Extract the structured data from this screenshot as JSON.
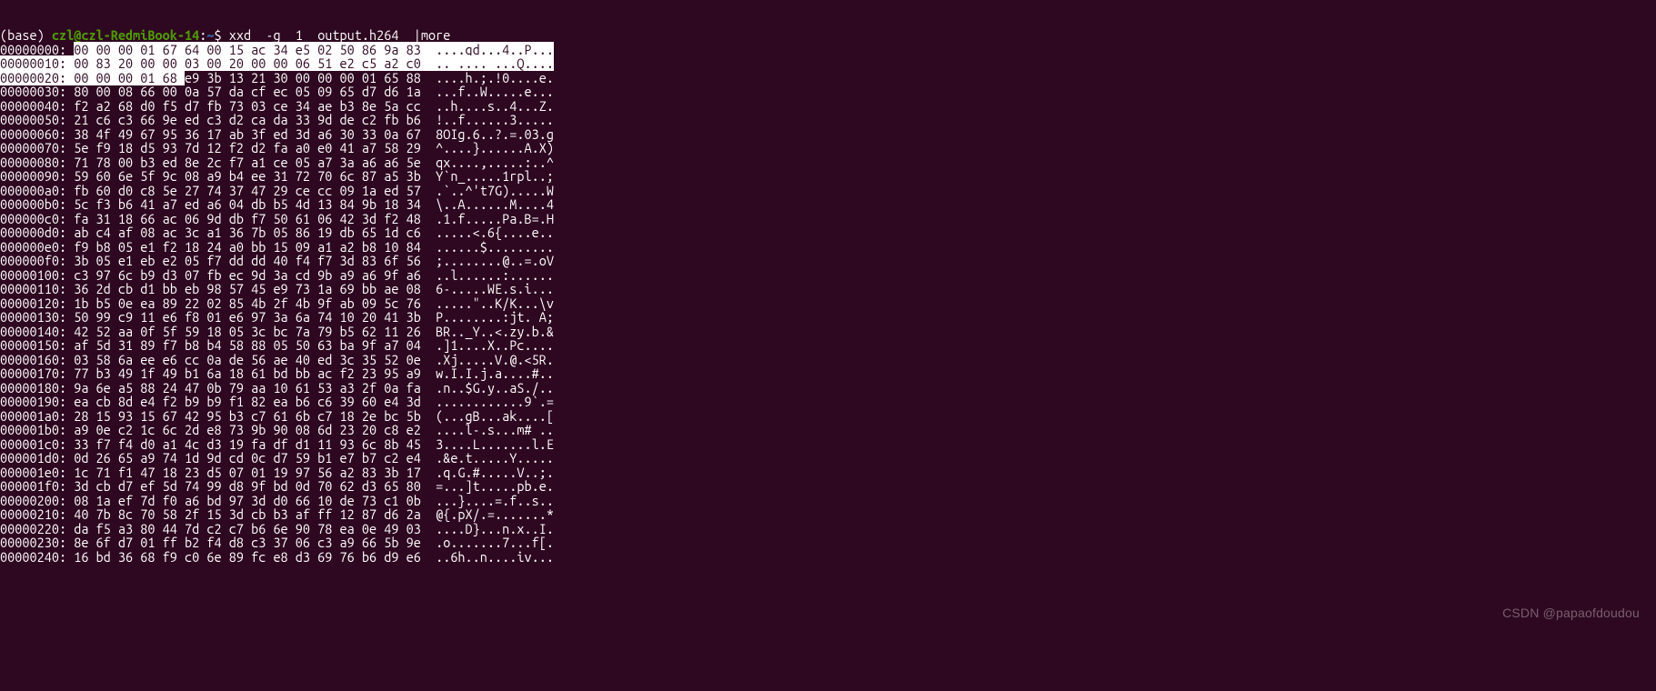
{
  "prompt": {
    "env": "(base) ",
    "user": "czl@czl-RedmiBook-14",
    "colon": ":",
    "path": "~",
    "dollar": "$ ",
    "command": "xxd  -g  1  output.h264  |more"
  },
  "lines": {
    "0": {
      "addr": "00000000: ",
      "sel": "00 00 00 01 67 64 00 15 ac 34 e5 02 50 86 9a 83  ....gd...4..P...",
      "rest": ""
    },
    "1": {
      "sel": "00000010: 00 83 20 00 00 03 00 20 00 00 06 51 e2 c5 a2 c0  .. .... ...Q....",
      "rest": ""
    },
    "2": {
      "sel": "00000020: 00 00 00 01 68 ",
      "rest": "e9 3b 13 21 30 00 00 00 01 65 88  ....h.;.!0....e."
    },
    "3": "00000030: 80 00 08 66 00 0a 57 da cf ec 05 09 65 d7 d6 1a  ...f..W.....e...",
    "4": "00000040: f2 a2 68 d0 f5 d7 fb 73 03 ce 34 ae b3 8e 5a cc  ..h....s..4...Z.",
    "5": "00000050: 21 c6 c3 66 9e ed c3 d2 ca da 33 9d de c2 fb b6  !..f......3.....",
    "6": "00000060: 38 4f 49 67 95 36 17 ab 3f ed 3d a6 30 33 0a 67  8OIg.6..?.=.03.g",
    "7": "00000070: 5e f9 18 d5 93 7d 12 f2 d2 fa a0 e0 41 a7 58 29  ^....}......A.X)",
    "8": "00000080: 71 78 00 b3 ed 8e 2c f7 a1 ce 05 a7 3a a6 a6 5e  qx....,.....:..^",
    "9": "00000090: 59 60 6e 5f 9c 08 a9 b4 ee 31 72 70 6c 87 a5 3b  Y`n_.....1rpl..;",
    "10": "000000a0: fb 60 d0 c8 5e 27 74 37 47 29 ce cc 09 1a ed 57  .`..^'t7G).....W",
    "11": "000000b0: 5c f3 b6 41 a7 ed a6 04 db b5 4d 13 84 9b 18 34  \\..A......M....4",
    "12": "000000c0: fa 31 18 66 ac 06 9d db f7 50 61 06 42 3d f2 48  .1.f.....Pa.B=.H",
    "13": "000000d0: ab c4 af 08 ac 3c a1 36 7b 05 86 19 db 65 1d c6  .....<.6{....e..",
    "14": "000000e0: f9 b8 05 e1 f2 18 24 a0 bb 15 09 a1 a2 b8 10 84  ......$.........",
    "15": "000000f0: 3b 05 e1 eb e2 05 f7 dd dd 40 f4 f7 3d 83 6f 56  ;........@..=.oV",
    "16": "00000100: c3 97 6c b9 d3 07 fb ec 9d 3a cd 9b a9 a6 9f a6  ..l......:......",
    "17": "00000110: 36 2d cb d1 bb eb 98 57 45 e9 73 1a 69 bb ae 08  6-.....WE.s.i...",
    "18": "00000120: 1b b5 0e ea 89 22 02 85 4b 2f 4b 9f ab 09 5c 76  .....\"..K/K...\\v",
    "19": "00000130: 50 99 c9 11 e6 f8 01 e6 97 3a 6a 74 10 20 41 3b  P........:jt. A;",
    "20": "00000140: 42 52 aa 0f 5f 59 18 05 3c bc 7a 79 b5 62 11 26  BR.._Y..<.zy.b.&",
    "21": "00000150: af 5d 31 89 f7 b8 b4 58 88 05 50 63 ba 9f a7 04  .]1....X..Pc....",
    "22": "00000160: 03 58 6a ee e6 cc 0a de 56 ae 40 ed 3c 35 52 0e  .Xj.....V.@.<5R.",
    "23": "00000170: 77 b3 49 1f 49 b1 6a 18 61 bd bb ac f2 23 95 a9  w.I.I.j.a....#..",
    "24": "00000180: 9a 6e a5 88 24 47 0b 79 aa 10 61 53 a3 2f 0a fa  .n..$G.y..aS./..",
    "25": "00000190: ea cb 8d e4 f2 b9 b9 f1 82 ea b6 c6 39 60 e4 3d  ............9`.=",
    "26": "000001a0: 28 15 93 15 67 42 95 b3 c7 61 6b c7 18 2e bc 5b  (...gB...ak....[",
    "27": "000001b0: a9 0e c2 1c 6c 2d e8 73 9b 90 08 6d 23 20 c8 e2  ....l-.s...m# ..",
    "28": "000001c0: 33 f7 f4 d0 a1 4c d3 19 fa df d1 11 93 6c 8b 45  3....L.......l.E",
    "29": "000001d0: 0d 26 65 a9 74 1d 9d cd 0c d7 59 b1 e7 b7 c2 e4  .&e.t.....Y.....",
    "30": "000001e0: 1c 71 f1 47 18 23 d5 07 01 19 97 56 a2 83 3b 17  .q.G.#.....V..;.",
    "31": "000001f0: 3d cb d7 ef 5d 74 99 d8 9f bd 0d 70 62 d3 65 80  =...]t.....pb.e.",
    "32": "00000200: 08 1a ef 7d f0 a6 bd 97 3d d0 66 10 de 73 c1 0b  ...}....=.f..s..",
    "33": "00000210: 40 7b 8c 70 58 2f 15 3d cb b3 af ff 12 87 d6 2a  @{.pX/.=.......*",
    "34": "00000220: da f5 a3 80 44 7d c2 c7 b6 6e 90 78 ea 0e 49 03  ....D}...n.x..I.",
    "35": "00000230: 8e 6f d7 01 ff b2 f4 d8 c3 37 06 c3 a9 66 5b 9e  .o.......7...f[.",
    "36": "00000240: 16 bd 36 68 f9 c0 6e 89 fc e8 d3 69 76 b6 d9 e6  ..6h..n....iv...",
    "37": "",
    "38": ""
  },
  "watermark": "CSDN @papaofdoudou"
}
